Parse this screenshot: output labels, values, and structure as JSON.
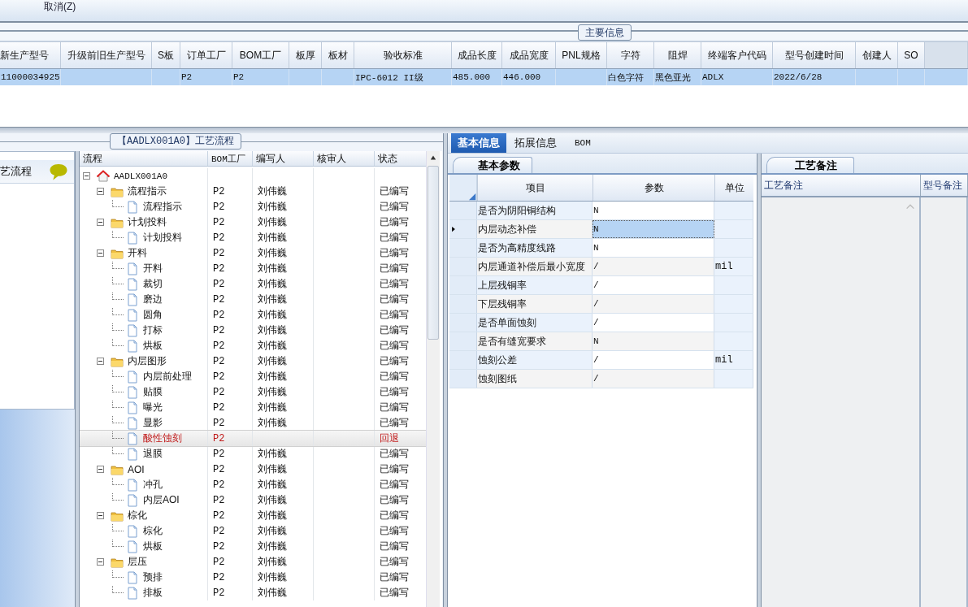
{
  "toolbar": {
    "buttons": [
      {
        "label": "取消(Z)"
      }
    ]
  },
  "main_info": {
    "title": "主要信息",
    "columns": [
      "新生产型号",
      "升级前旧生产型号",
      "S板",
      "订单工厂",
      "BOM工厂",
      "板厚",
      "板材",
      "验收标准",
      "成品长度",
      "成品宽度",
      "PNL规格",
      "字符",
      "阻焊",
      "终端客户代码",
      "型号创建时间",
      "创建人",
      "SO"
    ],
    "rows": [
      {
        "selected": true,
        "cells": [
          "11000034925",
          null,
          null,
          "P2",
          "P2",
          null,
          null,
          "IPC-6012 II级",
          "485.000",
          "446.000",
          null,
          "白色字符",
          "黑色亚光",
          "ADLX",
          "2022/6/28",
          null,
          null
        ]
      }
    ]
  },
  "flow": {
    "title": "【AADLX001A0】工艺流程",
    "sidebar": {
      "items": [
        {
          "label": "艺流程"
        }
      ]
    },
    "columns": [
      "流程",
      "BOM工厂",
      "编写人",
      "核审人",
      "状态"
    ],
    "nodes": [
      {
        "kind": "root",
        "label": "AADLX001A0",
        "selected": false,
        "expanded": true,
        "children": [
          {
            "kind": "folder",
            "label": "流程指示",
            "factory": "P2",
            "writer": "刘伟巍",
            "status": "已编写",
            "selected": false,
            "expanded": true,
            "children": [
              {
                "kind": "step",
                "label": "流程指示",
                "factory": "P2",
                "writer": "刘伟巍",
                "status": "已编写",
                "selected": false
              }
            ]
          },
          {
            "kind": "folder",
            "label": "计划投料",
            "factory": "P2",
            "writer": "刘伟巍",
            "status": "已编写",
            "selected": false,
            "expanded": true,
            "children": [
              {
                "kind": "step",
                "label": "计划投料",
                "factory": "P2",
                "writer": "刘伟巍",
                "status": "已编写",
                "selected": false
              }
            ]
          },
          {
            "kind": "folder",
            "label": "开料",
            "factory": "P2",
            "writer": "刘伟巍",
            "status": "已编写",
            "selected": false,
            "expanded": true,
            "children": [
              {
                "kind": "step",
                "label": "开料",
                "factory": "P2",
                "writer": "刘伟巍",
                "status": "已编写",
                "selected": false
              },
              {
                "kind": "step",
                "label": "裁切",
                "factory": "P2",
                "writer": "刘伟巍",
                "status": "已编写",
                "selected": false
              },
              {
                "kind": "step",
                "label": "磨边",
                "factory": "P2",
                "writer": "刘伟巍",
                "status": "已编写",
                "selected": false
              },
              {
                "kind": "step",
                "label": "圆角",
                "factory": "P2",
                "writer": "刘伟巍",
                "status": "已编写",
                "selected": false
              },
              {
                "kind": "step",
                "label": "打标",
                "factory": "P2",
                "writer": "刘伟巍",
                "status": "已编写",
                "selected": false
              },
              {
                "kind": "step",
                "label": "烘板",
                "factory": "P2",
                "writer": "刘伟巍",
                "status": "已编写",
                "selected": false
              }
            ]
          },
          {
            "kind": "folder",
            "label": "内层图形",
            "factory": "P2",
            "writer": "刘伟巍",
            "status": "已编写",
            "selected": false,
            "expanded": true,
            "children": [
              {
                "kind": "step",
                "label": "内层前处理",
                "factory": "P2",
                "writer": "刘伟巍",
                "status": "已编写",
                "selected": false
              },
              {
                "kind": "step",
                "label": "贴膜",
                "factory": "P2",
                "writer": "刘伟巍",
                "status": "已编写",
                "selected": false
              },
              {
                "kind": "step",
                "label": "曝光",
                "factory": "P2",
                "writer": "刘伟巍",
                "status": "已编写",
                "selected": false
              },
              {
                "kind": "step",
                "label": "显影",
                "factory": "P2",
                "writer": "刘伟巍",
                "status": "已编写",
                "selected": false
              },
              {
                "kind": "step",
                "label": "酸性蚀刻",
                "factory": "P2",
                "status": "回退",
                "selected": true
              },
              {
                "kind": "step",
                "label": "退膜",
                "factory": "P2",
                "writer": "刘伟巍",
                "status": "已编写",
                "selected": false
              }
            ]
          },
          {
            "kind": "folder",
            "label": "AOI",
            "factory": "P2",
            "writer": "刘伟巍",
            "status": "已编写",
            "selected": false,
            "expanded": true,
            "children": [
              {
                "kind": "step",
                "label": "冲孔",
                "factory": "P2",
                "writer": "刘伟巍",
                "status": "已编写",
                "selected": false
              },
              {
                "kind": "step",
                "label": "内层AOI",
                "factory": "P2",
                "writer": "刘伟巍",
                "status": "已编写",
                "selected": false
              }
            ]
          },
          {
            "kind": "folder",
            "label": "棕化",
            "factory": "P2",
            "writer": "刘伟巍",
            "status": "已编写",
            "selected": false,
            "expanded": true,
            "children": [
              {
                "kind": "step",
                "label": "棕化",
                "factory": "P2",
                "writer": "刘伟巍",
                "status": "已编写",
                "selected": false
              },
              {
                "kind": "step",
                "label": "烘板",
                "factory": "P2",
                "writer": "刘伟巍",
                "status": "已编写",
                "selected": false
              }
            ]
          },
          {
            "kind": "folder",
            "label": "层压",
            "factory": "P2",
            "writer": "刘伟巍",
            "status": "已编写",
            "selected": false,
            "expanded": true,
            "children": [
              {
                "kind": "step",
                "label": "预排",
                "factory": "P2",
                "writer": "刘伟巍",
                "status": "已编写",
                "selected": false
              },
              {
                "kind": "step",
                "label": "排板",
                "factory": "P2",
                "writer": "刘伟巍",
                "status": "已编写",
                "selected": false
              }
            ]
          }
        ]
      }
    ]
  },
  "detail": {
    "tabs": [
      {
        "label": "基本信息",
        "selected": true
      },
      {
        "label": "拓展信息",
        "selected": false
      },
      {
        "label": "BOM",
        "selected": false
      }
    ],
    "params": {
      "tab": "基本参数",
      "columns": [
        "项目",
        "参数",
        "单位"
      ],
      "rows": [
        {
          "item": "是否为阴阳铜结构",
          "value": "N",
          "selected": false
        },
        {
          "item": "内层动态补偿",
          "value": "N",
          "selected": true
        },
        {
          "item": "是否为高精度线路",
          "value": "N",
          "selected": false
        },
        {
          "item": "内层通道补偿后最小宽度",
          "value": "/",
          "unit": "mil",
          "selected": false
        },
        {
          "item": "上层残铜率",
          "value": "/",
          "selected": false
        },
        {
          "item": "下层残铜率",
          "value": "/",
          "selected": false
        },
        {
          "item": "是否单面蚀刻",
          "value": "/",
          "selected": false
        },
        {
          "item": "是否有缝宽要求",
          "value": "N",
          "selected": false
        },
        {
          "item": "蚀刻公差",
          "value": "/",
          "unit": "mil",
          "selected": false
        },
        {
          "item": "蚀刻图纸",
          "value": "/",
          "selected": false
        }
      ]
    },
    "notes": {
      "tab": "工艺备注",
      "columns": [
        "工艺备注",
        "型号备注"
      ]
    }
  }
}
